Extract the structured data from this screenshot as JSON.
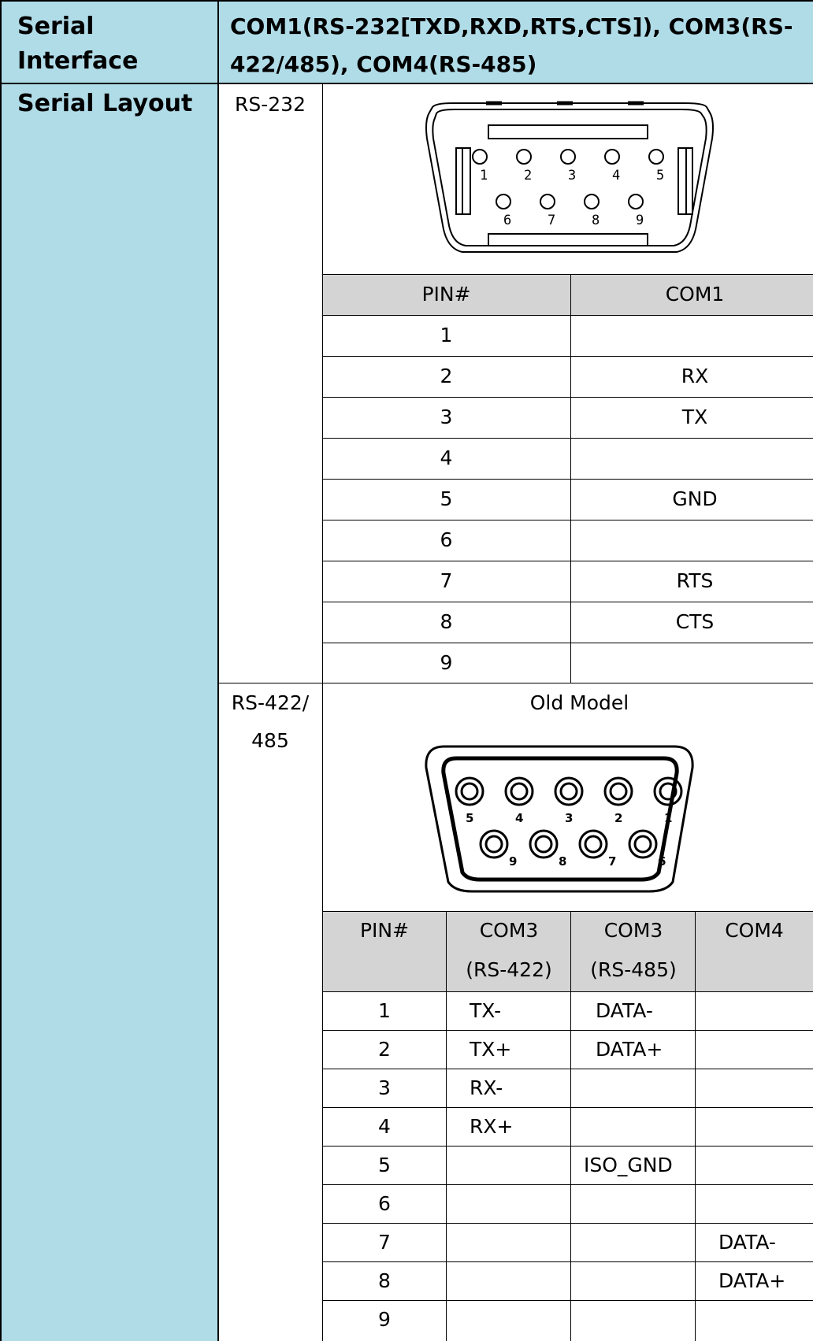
{
  "serial_interface": {
    "label": "Serial Interface",
    "value_line1": "COM1(RS-232[TXD,RXD,RTS,CTS]), COM3(RS-",
    "value_line2": "422/485), COM4(RS-485)"
  },
  "serial_layout": {
    "label": "Serial Layout",
    "rs232": {
      "label": "RS-232",
      "connector_top_pins": [
        "1",
        "2",
        "3",
        "4",
        "5"
      ],
      "connector_bottom_pins": [
        "6",
        "7",
        "8",
        "9"
      ],
      "table_headers": [
        "PIN#",
        "COM1"
      ],
      "rows": [
        {
          "pin": "1",
          "com1": ""
        },
        {
          "pin": "2",
          "com1": "RX"
        },
        {
          "pin": "3",
          "com1": "TX"
        },
        {
          "pin": "4",
          "com1": ""
        },
        {
          "pin": "5",
          "com1": "GND"
        },
        {
          "pin": "6",
          "com1": ""
        },
        {
          "pin": "7",
          "com1": "RTS"
        },
        {
          "pin": "8",
          "com1": "CTS"
        },
        {
          "pin": "9",
          "com1": ""
        }
      ]
    },
    "rs422": {
      "label_line1": "RS-422/",
      "label_line2": "485",
      "caption": "Old Model",
      "connector_top_pins": [
        "5",
        "4",
        "3",
        "2",
        "1"
      ],
      "connector_bottom_pins": [
        "9",
        "8",
        "7",
        "6"
      ],
      "table_headers": [
        {
          "line1": "PIN#",
          "line2": ""
        },
        {
          "line1": "COM3",
          "line2": "(RS-422)"
        },
        {
          "line1": "COM3",
          "line2": "(RS-485)"
        },
        {
          "line1": "COM4",
          "line2": ""
        }
      ],
      "rows": [
        {
          "pin": "1",
          "com3_422": "TX-",
          "com3_485": "DATA-",
          "com4": ""
        },
        {
          "pin": "2",
          "com3_422": "TX+",
          "com3_485": "DATA+",
          "com4": ""
        },
        {
          "pin": "3",
          "com3_422": "RX-",
          "com3_485": "",
          "com4": ""
        },
        {
          "pin": "4",
          "com3_422": "RX+",
          "com3_485": "",
          "com4": ""
        },
        {
          "pin": "5",
          "com3_422": "",
          "com3_485": "ISO_GND",
          "com4": ""
        },
        {
          "pin": "6",
          "com3_422": "",
          "com3_485": "",
          "com4": ""
        },
        {
          "pin": "7",
          "com3_422": "",
          "com3_485": "",
          "com4": "DATA-"
        },
        {
          "pin": "8",
          "com3_422": "",
          "com3_485": "",
          "com4": "DATA+"
        },
        {
          "pin": "9",
          "com3_422": "",
          "com3_485": "",
          "com4": ""
        }
      ]
    }
  },
  "colors": {
    "label_bg": "#b0dce8",
    "header_bg": "#d4d4d4",
    "border": "#000000"
  }
}
